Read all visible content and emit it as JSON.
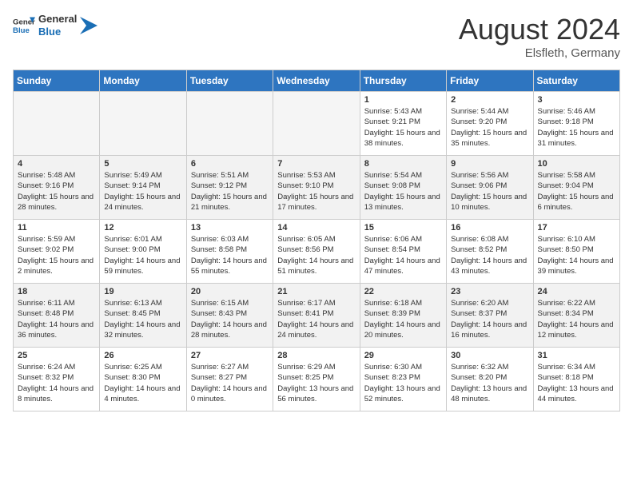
{
  "header": {
    "logo_general": "General",
    "logo_blue": "Blue",
    "month_year": "August 2024",
    "location": "Elsfleth, Germany"
  },
  "days_of_week": [
    "Sunday",
    "Monday",
    "Tuesday",
    "Wednesday",
    "Thursday",
    "Friday",
    "Saturday"
  ],
  "weeks": [
    [
      {
        "day": "",
        "empty": true
      },
      {
        "day": "",
        "empty": true
      },
      {
        "day": "",
        "empty": true
      },
      {
        "day": "",
        "empty": true
      },
      {
        "day": "1",
        "sunrise": "5:43 AM",
        "sunset": "9:21 PM",
        "daylight": "15 hours and 38 minutes."
      },
      {
        "day": "2",
        "sunrise": "5:44 AM",
        "sunset": "9:20 PM",
        "daylight": "15 hours and 35 minutes."
      },
      {
        "day": "3",
        "sunrise": "5:46 AM",
        "sunset": "9:18 PM",
        "daylight": "15 hours and 31 minutes."
      }
    ],
    [
      {
        "day": "4",
        "sunrise": "5:48 AM",
        "sunset": "9:16 PM",
        "daylight": "15 hours and 28 minutes."
      },
      {
        "day": "5",
        "sunrise": "5:49 AM",
        "sunset": "9:14 PM",
        "daylight": "15 hours and 24 minutes."
      },
      {
        "day": "6",
        "sunrise": "5:51 AM",
        "sunset": "9:12 PM",
        "daylight": "15 hours and 21 minutes."
      },
      {
        "day": "7",
        "sunrise": "5:53 AM",
        "sunset": "9:10 PM",
        "daylight": "15 hours and 17 minutes."
      },
      {
        "day": "8",
        "sunrise": "5:54 AM",
        "sunset": "9:08 PM",
        "daylight": "15 hours and 13 minutes."
      },
      {
        "day": "9",
        "sunrise": "5:56 AM",
        "sunset": "9:06 PM",
        "daylight": "15 hours and 10 minutes."
      },
      {
        "day": "10",
        "sunrise": "5:58 AM",
        "sunset": "9:04 PM",
        "daylight": "15 hours and 6 minutes."
      }
    ],
    [
      {
        "day": "11",
        "sunrise": "5:59 AM",
        "sunset": "9:02 PM",
        "daylight": "15 hours and 2 minutes."
      },
      {
        "day": "12",
        "sunrise": "6:01 AM",
        "sunset": "9:00 PM",
        "daylight": "14 hours and 59 minutes."
      },
      {
        "day": "13",
        "sunrise": "6:03 AM",
        "sunset": "8:58 PM",
        "daylight": "14 hours and 55 minutes."
      },
      {
        "day": "14",
        "sunrise": "6:05 AM",
        "sunset": "8:56 PM",
        "daylight": "14 hours and 51 minutes."
      },
      {
        "day": "15",
        "sunrise": "6:06 AM",
        "sunset": "8:54 PM",
        "daylight": "14 hours and 47 minutes."
      },
      {
        "day": "16",
        "sunrise": "6:08 AM",
        "sunset": "8:52 PM",
        "daylight": "14 hours and 43 minutes."
      },
      {
        "day": "17",
        "sunrise": "6:10 AM",
        "sunset": "8:50 PM",
        "daylight": "14 hours and 39 minutes."
      }
    ],
    [
      {
        "day": "18",
        "sunrise": "6:11 AM",
        "sunset": "8:48 PM",
        "daylight": "14 hours and 36 minutes."
      },
      {
        "day": "19",
        "sunrise": "6:13 AM",
        "sunset": "8:45 PM",
        "daylight": "14 hours and 32 minutes."
      },
      {
        "day": "20",
        "sunrise": "6:15 AM",
        "sunset": "8:43 PM",
        "daylight": "14 hours and 28 minutes."
      },
      {
        "day": "21",
        "sunrise": "6:17 AM",
        "sunset": "8:41 PM",
        "daylight": "14 hours and 24 minutes."
      },
      {
        "day": "22",
        "sunrise": "6:18 AM",
        "sunset": "8:39 PM",
        "daylight": "14 hours and 20 minutes."
      },
      {
        "day": "23",
        "sunrise": "6:20 AM",
        "sunset": "8:37 PM",
        "daylight": "14 hours and 16 minutes."
      },
      {
        "day": "24",
        "sunrise": "6:22 AM",
        "sunset": "8:34 PM",
        "daylight": "14 hours and 12 minutes."
      }
    ],
    [
      {
        "day": "25",
        "sunrise": "6:24 AM",
        "sunset": "8:32 PM",
        "daylight": "14 hours and 8 minutes."
      },
      {
        "day": "26",
        "sunrise": "6:25 AM",
        "sunset": "8:30 PM",
        "daylight": "14 hours and 4 minutes."
      },
      {
        "day": "27",
        "sunrise": "6:27 AM",
        "sunset": "8:27 PM",
        "daylight": "14 hours and 0 minutes."
      },
      {
        "day": "28",
        "sunrise": "6:29 AM",
        "sunset": "8:25 PM",
        "daylight": "13 hours and 56 minutes."
      },
      {
        "day": "29",
        "sunrise": "6:30 AM",
        "sunset": "8:23 PM",
        "daylight": "13 hours and 52 minutes."
      },
      {
        "day": "30",
        "sunrise": "6:32 AM",
        "sunset": "8:20 PM",
        "daylight": "13 hours and 48 minutes."
      },
      {
        "day": "31",
        "sunrise": "6:34 AM",
        "sunset": "8:18 PM",
        "daylight": "13 hours and 44 minutes."
      }
    ]
  ],
  "labels": {
    "sunrise": "Sunrise:",
    "sunset": "Sunset:",
    "daylight": "Daylight:"
  }
}
